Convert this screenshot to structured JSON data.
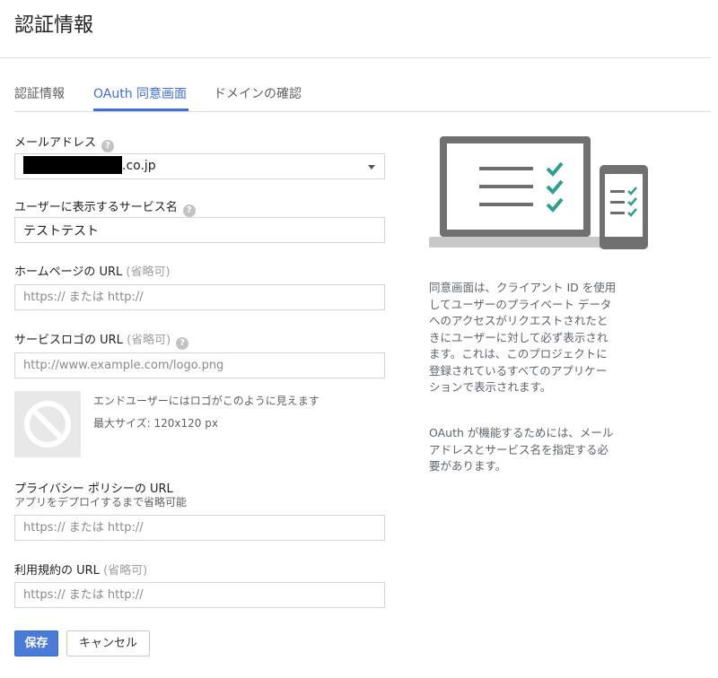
{
  "page": {
    "title": "認証情報"
  },
  "tabs": [
    {
      "label": "認証情報",
      "active": false
    },
    {
      "label": "OAuth 同意画面",
      "active": true
    },
    {
      "label": "ドメインの確認",
      "active": false
    }
  ],
  "form": {
    "email": {
      "label": "メールアドレス",
      "value_suffix": ".co.jp",
      "help_icon": "question-mark-icon"
    },
    "service_name": {
      "label": "ユーザーに表示するサービス名",
      "value": "テストテスト",
      "help_icon": "question-mark-icon"
    },
    "homepage_url": {
      "label": "ホームページの URL",
      "optional": "(省略可)",
      "placeholder": "https:// または http://"
    },
    "logo_url": {
      "label": "サービスロゴの URL",
      "optional": "(省略可)",
      "placeholder": "http://www.example.com/logo.png",
      "help_icon": "question-mark-icon"
    },
    "logo_preview": {
      "text": "エンドユーザーにはロゴがこのように見えます",
      "max_size": "最大サイズ: 120x120 px",
      "icon": "no-image-icon"
    },
    "privacy_url": {
      "label": "プライバシー ポリシーの URL",
      "sub_label": "アプリをデプロイするまで省略可能",
      "placeholder": "https:// または http://"
    },
    "tos_url": {
      "label": "利用規約の URL",
      "optional": "(省略可)",
      "placeholder": "https:// または http://"
    }
  },
  "buttons": {
    "save": "保存",
    "cancel": "キャンセル"
  },
  "sidebar": {
    "description_lines": [
      "同意画面は、クライアント ID を使用",
      "してユーザーのプライベート データ",
      "へのアクセスがリクエストされたと",
      "きにユーザーに対して必ず表示され",
      "ます。これは、このプロジェクトに",
      "登録されているすべてのアプリケー",
      "ションで表示されます。"
    ],
    "note_lines": [
      "OAuth が機能するためには、メール",
      "アドレスとサービス名を指定する必",
      "要があります。"
    ]
  },
  "colors": {
    "accent": "#3f6fd6",
    "save_button": "#4a7bd9",
    "check": "#2e9e8f",
    "device": "#707070"
  }
}
